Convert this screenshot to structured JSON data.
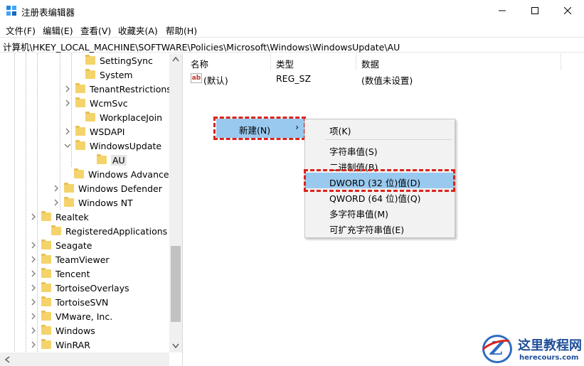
{
  "window": {
    "title": "注册表编辑器",
    "controls": {
      "minimize": "─",
      "maximize": "☐",
      "close": "✕"
    }
  },
  "menubar": {
    "items": [
      "文件(F)",
      "编辑(E)",
      "查看(V)",
      "收藏夹(A)",
      "帮助(H)"
    ]
  },
  "address": "计算机\\HKEY_LOCAL_MACHINE\\SOFTWARE\\Policies\\Microsoft\\Windows\\WindowsUpdate\\AU",
  "tree": {
    "items": [
      {
        "label": "SettingSync",
        "expandable": false,
        "selected": false
      },
      {
        "label": "System",
        "expandable": false,
        "selected": false
      },
      {
        "label": "TenantRestrictions",
        "expandable": true,
        "selected": false
      },
      {
        "label": "WcmSvc",
        "expandable": true,
        "selected": false
      },
      {
        "label": "WorkplaceJoin",
        "expandable": false,
        "selected": false
      },
      {
        "label": "WSDAPI",
        "expandable": true,
        "selected": false
      },
      {
        "label": "WindowsUpdate",
        "expandable": true,
        "expanded": true,
        "selected": false
      },
      {
        "label": "AU",
        "expandable": false,
        "selected": true
      },
      {
        "label": "Windows Advanced",
        "expandable": false,
        "selected": false
      },
      {
        "label": "Windows Defender",
        "expandable": true,
        "selected": false
      },
      {
        "label": "Windows NT",
        "expandable": true,
        "selected": false
      },
      {
        "label": "Realtek",
        "expandable": true,
        "selected": false
      },
      {
        "label": "RegisteredApplications",
        "expandable": false,
        "selected": false
      },
      {
        "label": "Seagate",
        "expandable": true,
        "selected": false
      },
      {
        "label": "TeamViewer",
        "expandable": true,
        "selected": false
      },
      {
        "label": "Tencent",
        "expandable": true,
        "selected": false
      },
      {
        "label": "TortoiseOverlays",
        "expandable": true,
        "selected": false
      },
      {
        "label": "TortoiseSVN",
        "expandable": true,
        "selected": false
      },
      {
        "label": "VMware, Inc.",
        "expandable": true,
        "selected": false
      },
      {
        "label": "Windows",
        "expandable": true,
        "selected": false
      },
      {
        "label": "WinRAR",
        "expandable": true,
        "selected": false
      }
    ]
  },
  "values_table": {
    "columns": [
      "名称",
      "类型",
      "数据"
    ],
    "rows": [
      {
        "name": "(默认)",
        "type": "REG_SZ",
        "data": "(数值未设置)",
        "icon": "ab"
      }
    ]
  },
  "context_menu": {
    "new_label": "新建(N)",
    "new_arrow": "›",
    "submenu": [
      {
        "label": "项(K)",
        "highlighted": false
      },
      {
        "label": "字符串值(S)",
        "highlighted": false
      },
      {
        "label": "二进制值(B)",
        "highlighted": false
      },
      {
        "label": "DWORD (32 位)值(D)",
        "highlighted": true
      },
      {
        "label": "QWORD (64 位)值(Q)",
        "highlighted": false
      },
      {
        "label": "多字符串值(M)",
        "highlighted": false
      },
      {
        "label": "可扩充字符串值(E)",
        "highlighted": false
      }
    ]
  },
  "watermark": {
    "title": "这里教程网",
    "url": "herecours.com"
  },
  "colors": {
    "highlight": "#99c9ef",
    "annotation_red": "#d9241c",
    "folder": "#f4d36b"
  }
}
